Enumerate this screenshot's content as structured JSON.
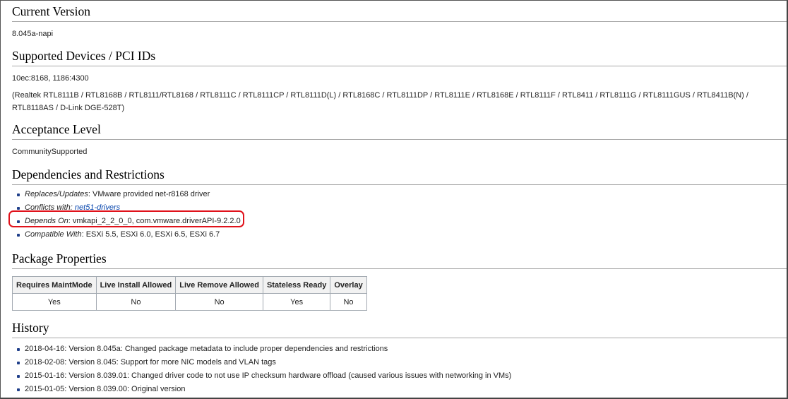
{
  "sections": {
    "current_version": {
      "title": "Current Version",
      "value": "8.045a-napi"
    },
    "supported_devices": {
      "title": "Supported Devices / PCI IDs",
      "pci_ids": "10ec:8168, 1186:4300",
      "models": "(Realtek RTL8111B / RTL8168B / RTL8111/RTL8168 / RTL8111C / RTL8111CP / RTL8111D(L) / RTL8168C / RTL8111DP / RTL8111E / RTL8168E / RTL8111F / RTL8411 / RTL8111G / RTL8111GUS / RTL8411B(N) / RTL8118AS / D-Link DGE-528T)"
    },
    "acceptance_level": {
      "title": "Acceptance Level",
      "value": "CommunitySupported"
    },
    "dependencies": {
      "title": "Dependencies and Restrictions",
      "items": [
        {
          "key": "Replaces/Updates",
          "value": ": VMware provided net-r8168 driver"
        },
        {
          "key": "Conflicts with: ",
          "link": "net51-drivers"
        },
        {
          "key": "Depends On",
          "value": ": vmkapi_2_2_0_0, com.vmware.driverAPI-9.2.2.0",
          "highlighted": true
        },
        {
          "key": "Compatible With",
          "value": ": ESXi 5.5, ESXi 6.0, ESXi 6.5, ESXi 6.7"
        }
      ],
      "highlight_color": "#e0121b"
    },
    "package_properties": {
      "title": "Package Properties",
      "headers": [
        "Requires MaintMode",
        "Live Install Allowed",
        "Live Remove Allowed",
        "Stateless Ready",
        "Overlay"
      ],
      "values": [
        "Yes",
        "No",
        "No",
        "Yes",
        "No"
      ]
    },
    "history": {
      "title": "History",
      "items": [
        "2018-04-16: Version 8.045a: Changed package metadata to include proper dependencies and restrictions",
        "2018-02-08: Version 8.045: Support for more NIC models and VLAN tags",
        "2015-01-16: Version 8.039.01: Changed driver code to not use IP checksum hardware offload (caused various issues with networking in VMs)",
        "2015-01-05: Version 8.039.00: Original version"
      ]
    }
  },
  "colors": {
    "link": "#0645ad",
    "bullet": "#1f3f8a",
    "rule": "#a9a9a9",
    "table_header_bg": "#f2f2f2"
  }
}
